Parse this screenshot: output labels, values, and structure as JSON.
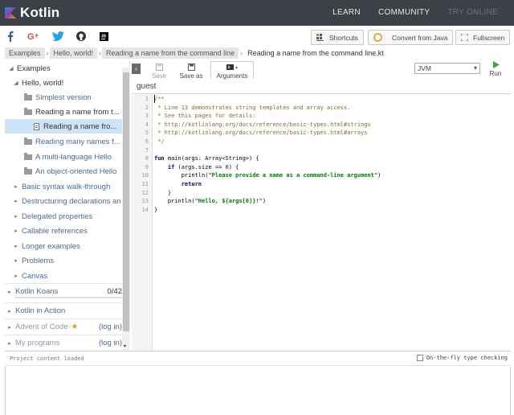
{
  "brand": {
    "name": "Kotlin"
  },
  "topnav": {
    "links": [
      "LEARN",
      "COMMUNITY",
      "TRY ONLINE"
    ]
  },
  "toolbar": {
    "shortcuts": "Shortcuts",
    "convert": "Convert from Java",
    "fullscreen": "Fullscreen"
  },
  "breadcrumbs": [
    "Examples",
    "Hello, world!",
    "Reading a name from the command line",
    "Reading a name from the command line.kt"
  ],
  "sidebar": {
    "items": [
      {
        "label": "Examples"
      },
      {
        "label": "Hello, world!"
      },
      {
        "label": "Simplest version"
      },
      {
        "label": "Reading a name from t..."
      },
      {
        "label": "Reading a name fro..."
      },
      {
        "label": "Reading many names f..."
      },
      {
        "label": "A multi-language Hello"
      },
      {
        "label": "An object-oriented Hello"
      },
      {
        "label": "Basic syntax walk-through"
      },
      {
        "label": "Destructuring declarations an"
      },
      {
        "label": "Delegated properties"
      },
      {
        "label": "Callable references"
      },
      {
        "label": "Longer examples"
      },
      {
        "label": "Problems"
      },
      {
        "label": "Canvas"
      }
    ],
    "sections": {
      "koans": {
        "label": "Kotlin Koans",
        "count": "0/42"
      },
      "in_action": {
        "label": "Kotlin in Action"
      },
      "advent": {
        "label": "Advent of Code",
        "login": "(log in)"
      },
      "programs": {
        "label": "My programs",
        "login": "(log in)"
      }
    }
  },
  "editor": {
    "tabs": {
      "save": "Save",
      "save_as": "Save as",
      "arguments": "Arguments"
    },
    "platform": "JVM",
    "run": "Run",
    "args_user": "guest",
    "line_numbers": [
      "1",
      "2",
      "3",
      "4",
      "5",
      "6",
      "7",
      "8",
      "9",
      "10",
      "11",
      "12",
      "13",
      "14"
    ],
    "code": {
      "l1": "/**",
      "l2": " * Line 13 demonstrates string templates and array access.",
      "l3": " * See this pages for details:",
      "l4": " * http://kotlinlang.org/docs/reference/basic-types.html#strings",
      "l5": " * http://kotlinlang.org/docs/reference/basic-types.html#arrays",
      "l6": " */",
      "l8a": "fun",
      "l8b": " main(args: Array<String>) {",
      "l9a": "    if",
      "l9b": " (args.size == ",
      "l9c": "0",
      "l9d": ") {",
      "l10a": "        println(",
      "l10b": "\"Please provide a name as a command-line argument\"",
      "l10c": ")",
      "l11": "        return",
      "l12": "    }",
      "l13a": "    println(",
      "l13b": "\"Hello, ${args[0]}!\"",
      "l13c": ")",
      "l14": "}"
    }
  },
  "console": {
    "message": "Project content loaded",
    "checkbox_label": "On-the-fly type checking"
  },
  "colors": {
    "topnav": "#3c4147",
    "link": "#4a6a9a",
    "selection": "#cde3f7"
  }
}
